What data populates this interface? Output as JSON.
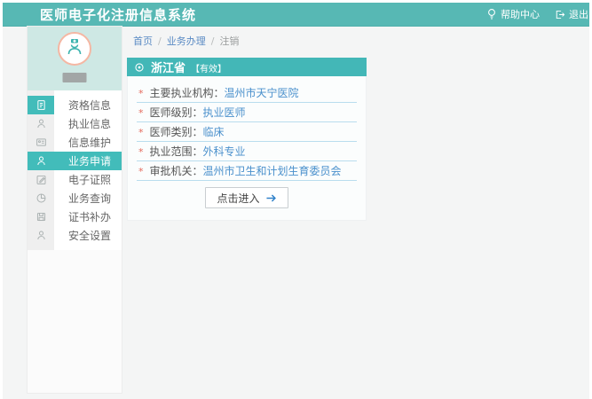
{
  "header": {
    "title": "医师电子化注册信息系统",
    "help_label": "帮助中心",
    "logout_label": "退出"
  },
  "breadcrumb": {
    "separator": "/",
    "items": [
      {
        "label": "首页"
      },
      {
        "label": "业务办理"
      },
      {
        "label": "注销"
      }
    ]
  },
  "sidebar": {
    "avatar_icon": "doctor-avatar-icon",
    "items": [
      {
        "label": "资格信息",
        "icon": "document-icon"
      },
      {
        "label": "执业信息",
        "icon": "person-icon"
      },
      {
        "label": "信息维护",
        "icon": "id-card-icon"
      },
      {
        "label": "业务申请",
        "icon": "person-icon",
        "active": true
      },
      {
        "label": "电子证照",
        "icon": "edit-square-icon"
      },
      {
        "label": "业务查询",
        "icon": "pie-chart-icon"
      },
      {
        "label": "证书补办",
        "icon": "floppy-icon"
      },
      {
        "label": "安全设置",
        "icon": "person-icon"
      }
    ]
  },
  "card": {
    "region": "浙江省",
    "status": "【有效】",
    "required_marker": "*",
    "fields": [
      {
        "label": "主要执业机构：",
        "value": "温州市天宁医院"
      },
      {
        "label": "医师级别：",
        "value": "执业医师"
      },
      {
        "label": "医师类别：",
        "value": "临床"
      },
      {
        "label": "执业范围：",
        "value": "外科专业"
      },
      {
        "label": "审批机关：",
        "value": "温州市卫生和计划生育委员会"
      }
    ],
    "button_label": "点击进入"
  },
  "colors": {
    "header_teal": "#57b8b4",
    "accent_teal": "#43b7b7",
    "sidebar_active_teal": "#42bcba",
    "avatar_panel_teal": "#cee8e4",
    "avatar_ring_pink": "#f5b7a3",
    "link_blue": "#4a90cc",
    "breadcrumb_blue": "#5b8bc4",
    "divider_blue": "#b9ddee",
    "required_red": "#e4695c",
    "content_bg": "#f4f5f5"
  }
}
